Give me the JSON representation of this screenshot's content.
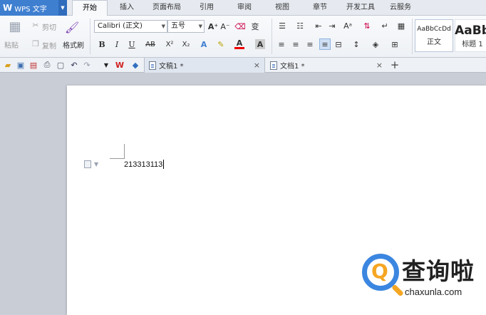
{
  "app": {
    "logo": "W",
    "title": "WPS 文字"
  },
  "menu_tabs": [
    {
      "label": "开始",
      "active": true
    },
    {
      "label": "插入"
    },
    {
      "label": "页面布局"
    },
    {
      "label": "引用"
    },
    {
      "label": "审阅"
    },
    {
      "label": "视图"
    },
    {
      "label": "章节"
    },
    {
      "label": "开发工具"
    },
    {
      "label": "云服务"
    }
  ],
  "clipboard": {
    "paste": "粘贴",
    "cut": "剪切",
    "copy": "复制",
    "format_painter": "格式刷"
  },
  "font": {
    "name": "Calibri (正文)",
    "size": "五号"
  },
  "format_buttons": {
    "bold": "B",
    "italic": "I",
    "underline": "U",
    "strike": "AB",
    "superscript": "X²",
    "subscript": "X₂",
    "font_color": "A",
    "text_effect": "A",
    "grow": "A⁺",
    "shrink": "A⁻",
    "phonetic": "变",
    "char_shade": "A"
  },
  "styles": [
    {
      "sample": "AaBbCcDd",
      "name": "正文"
    },
    {
      "sample": "AaBb",
      "name": "标题 1"
    }
  ],
  "doc_tabs": [
    {
      "label": "文稿1 *",
      "active": true
    },
    {
      "label": "文档1 *",
      "active": false
    }
  ],
  "toolbar": {
    "new_tab": "+",
    "close": "×"
  },
  "document": {
    "text": "213313113"
  },
  "watermark": {
    "cn": "查询啦",
    "en": "chaxunla.com",
    "icon_glyph": "Q"
  },
  "colors": {
    "accent": "#3f7fd0",
    "watermark_blue": "#3b86e0",
    "watermark_orange": "#f5a623"
  },
  "icons": [
    "folder-open-icon",
    "save-icon",
    "export-pdf-icon",
    "print-icon",
    "print-preview-icon",
    "undo-icon",
    "redo-icon",
    "wps-logo-icon",
    "cloud-cube-icon",
    "document-icon"
  ]
}
